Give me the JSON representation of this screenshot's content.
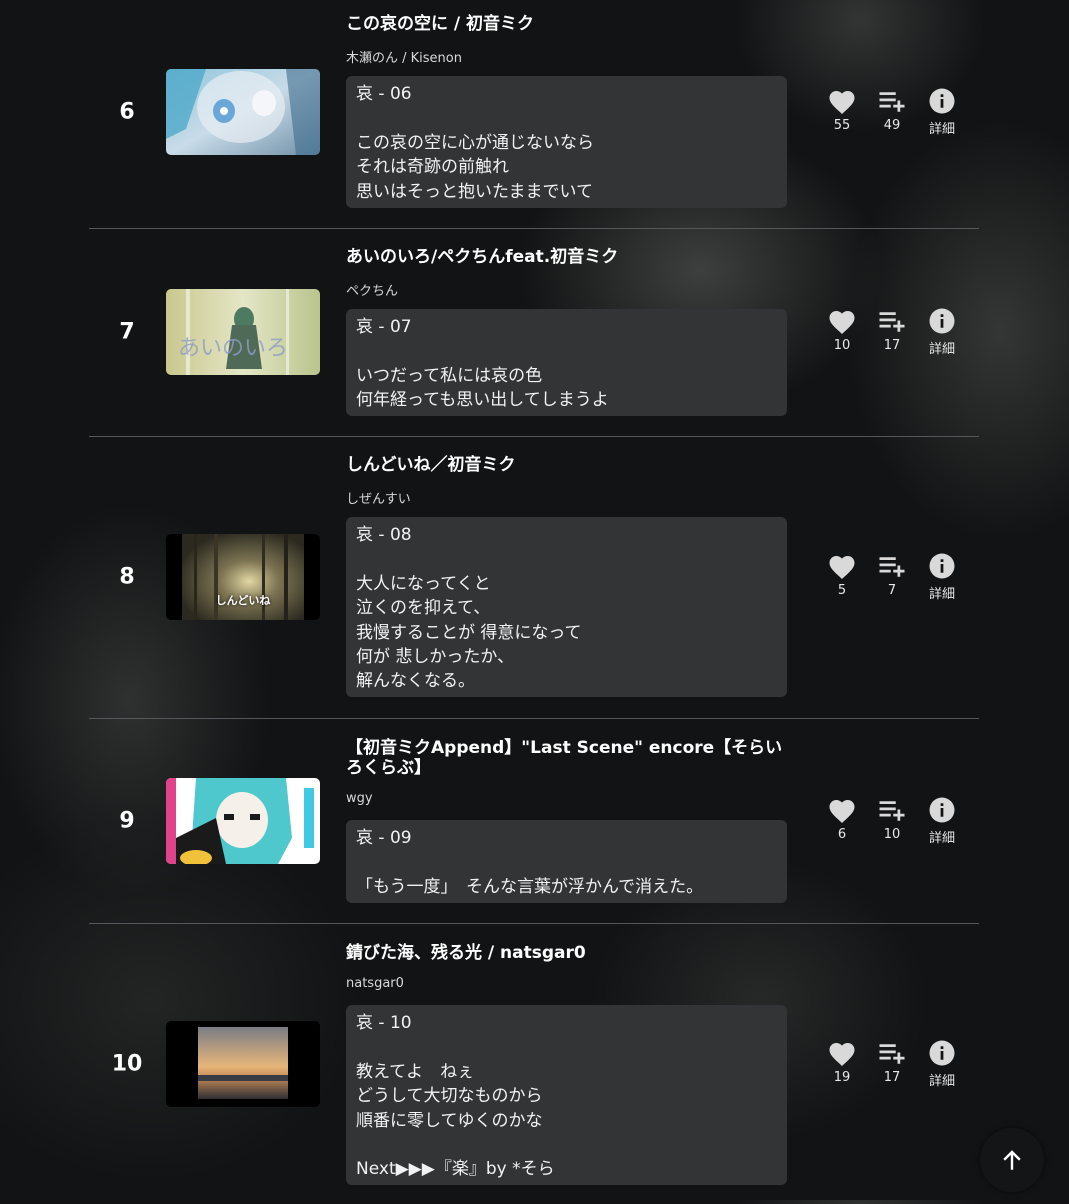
{
  "ranking": [
    {
      "rank": "6",
      "title": "この哀の空に / 初音ミク",
      "artist": "木瀬のん / Kisenon",
      "comment": [
        "哀 - 06",
        "",
        "この哀の空に心が通じないなら",
        "それは奇跡の前触れ",
        "思いはそっと抱いたままでいて"
      ],
      "likes": "55",
      "playlist_adds": "49",
      "info_label": "詳細"
    },
    {
      "rank": "7",
      "title": "あいのいろ/ペクちんfeat.初音ミク",
      "artist": "ペクちん",
      "comment": [
        "哀 - 07",
        "",
        "いつだって私には哀の色",
        "何年経っても思い出してしまうよ"
      ],
      "likes": "10",
      "playlist_adds": "17",
      "info_label": "詳細"
    },
    {
      "rank": "8",
      "title": "しんどいね／初音ミク",
      "artist": "しぜんすい",
      "thumbnail_caption": "しんどいね",
      "comment": [
        "哀 - 08",
        "",
        "大人になってくと",
        "泣くのを抑えて、",
        "我慢することが 得意になって",
        "何が 悲しかったか、",
        "解んなくなる。"
      ],
      "likes": "5",
      "playlist_adds": "7",
      "info_label": "詳細"
    },
    {
      "rank": "9",
      "title": "【初音ミクAppend】\"Last Scene\" encore【そらいろくらぶ】",
      "artist": "wgy",
      "comment": [
        "哀 - 09",
        "",
        "「もう一度」　そんな言葉が浮かんで消えた。"
      ],
      "likes": "6",
      "playlist_adds": "10",
      "info_label": "詳細"
    },
    {
      "rank": "10",
      "title": "錆びた海、残る光 / natsgar0",
      "artist": "natsgar0",
      "comment": [
        "哀 - 10",
        "",
        "教えてよ　ねぇ",
        "どうして大切なものから",
        "順番に零してゆくのかな",
        "",
        "Next▶︎▶︎▶︎『楽』by *そら"
      ],
      "likes": "19",
      "playlist_adds": "17",
      "info_label": "詳細"
    }
  ],
  "icons": {
    "like": "heart-icon",
    "playlist": "playlist-add-icon",
    "info": "info-icon",
    "scroll_top": "arrow-up-icon"
  },
  "colors": {
    "background": "#121314",
    "card": "#333436",
    "text": "#ffffff"
  }
}
